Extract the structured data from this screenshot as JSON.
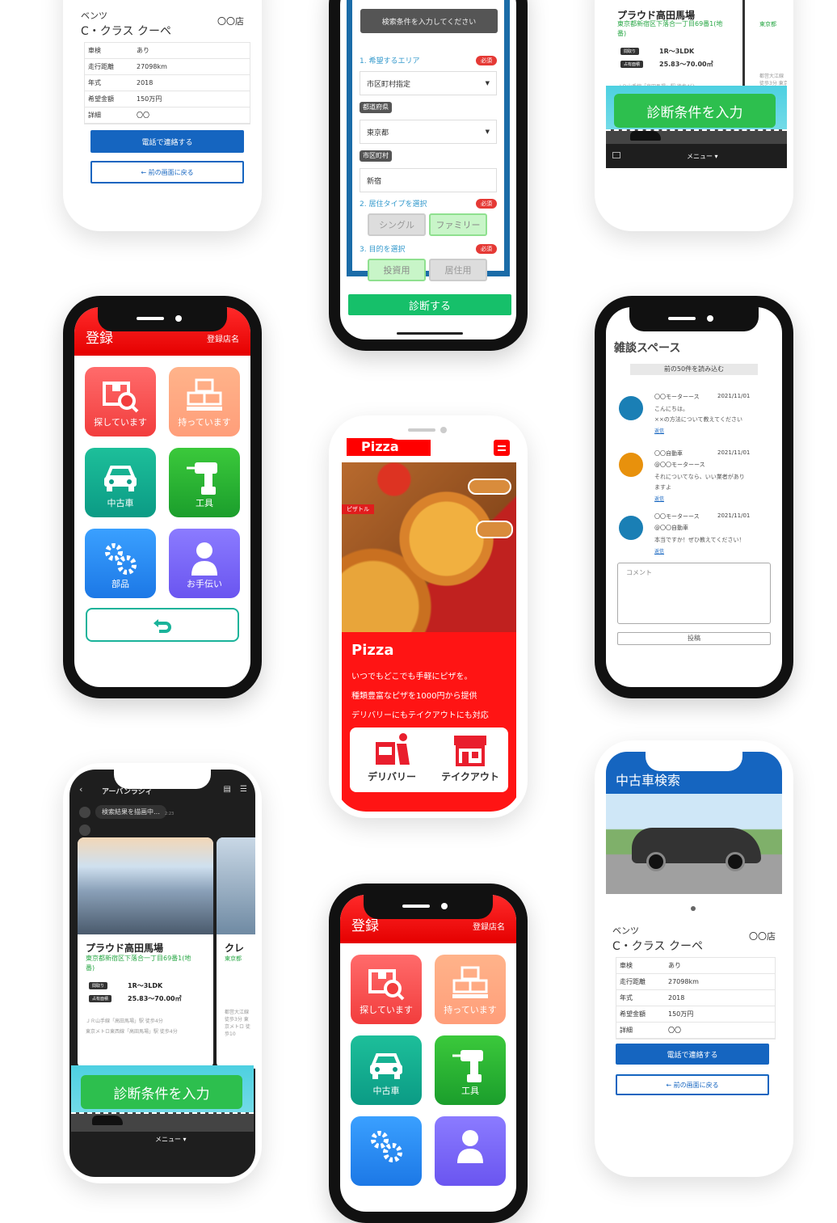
{
  "car_detail": {
    "brand": "ベンツ",
    "model": "C・クラス クーペ",
    "shop": "〇〇店",
    "specs": [
      {
        "k": "車検",
        "v": "あり"
      },
      {
        "k": "走行距離",
        "v": "27098km"
      },
      {
        "k": "年式",
        "v": "2018"
      },
      {
        "k": "希望金額",
        "v": "150万円"
      },
      {
        "k": "詳細",
        "v": "〇〇"
      }
    ],
    "call_label": "電話で連絡する",
    "back_label": "← 前の画面に戻る"
  },
  "search_form": {
    "banner": "検索条件を入力してください",
    "area_label": "1. 希望するエリア",
    "required": "必須",
    "area_value": "市区町村指定",
    "pref_tag": "都道府県",
    "pref_value": "東京都",
    "city_tag": "市区町村",
    "city_value": "新宿",
    "type_label": "2. 居住タイプを選択",
    "type_options": [
      "シングル",
      "ファミリー"
    ],
    "purpose_label": "3. 目的を選択",
    "purpose_options": [
      "投資用",
      "居住用"
    ],
    "submit": "診断する"
  },
  "property": {
    "name": "プラウド高田馬場",
    "address": "東京都新宿区下落合一丁目69番1(地番)",
    "badge_layout": "間取り",
    "badge_area": "占有面積",
    "layout": "1R〜3LDK",
    "area": "25.83〜70.00㎡",
    "access1": "ＪＲ山手線「高田馬場」駅 徒歩4分",
    "access2": "東京メトロ東西線「高田馬場」駅 徒歩4分",
    "next_name": "クレ",
    "next_address": "東京都",
    "next_access": "都営大江線 徒歩3分 東京メトロ 徒歩10",
    "cta": "診断条件を入力",
    "menu": "メニュー ▾",
    "chat_header": "アーバンラシィ",
    "chat_msg": "検索結果を描画中…",
    "chat_time": "2:23"
  },
  "menu_app": {
    "title": "登録",
    "shop": "登録店名",
    "tiles": [
      "探しています",
      "持っています",
      "中古車",
      "工具",
      "部品",
      "お手伝い"
    ]
  },
  "chat": {
    "title": "雑談スペース",
    "load_more": "前の50件を読み込む",
    "posts": [
      {
        "name": "〇〇モーターース",
        "date": "2021/11/01",
        "to": "",
        "body": "こんにちは。\n××の方法について教えてください",
        "reply": "返信",
        "color": "#1a7fb5"
      },
      {
        "name": "〇〇自動車",
        "date": "2021/11/01",
        "to": "@〇〇モーターース",
        "body": "それについてなら、いい業者があり\nますよ",
        "reply": "返信",
        "color": "#e8910c"
      },
      {
        "name": "〇〇モーターース",
        "date": "2021/11/01",
        "to": "@〇〇自動車",
        "body": "本当ですか！ぜひ教えてください！",
        "reply": "返信",
        "color": "#1a7fb5"
      }
    ],
    "comment_placeholder": "コメント",
    "post_label": "投稿"
  },
  "pizza": {
    "logo": "Pizza",
    "heading": "Pizza",
    "lines": [
      "いつでもどこでも手軽にピザを。",
      "種類豊富なピザを1000円から提供",
      "デリバリーにもテイクアウトにも対応"
    ],
    "delivery": "デリバリー",
    "takeout": "テイクアウト",
    "box_label": "ピザトル"
  },
  "used_car": {
    "title": "中古車検索"
  },
  "colors": {
    "brand_red": "#ff1a1a",
    "blue": "#1565c0",
    "green": "#1faf5a"
  }
}
